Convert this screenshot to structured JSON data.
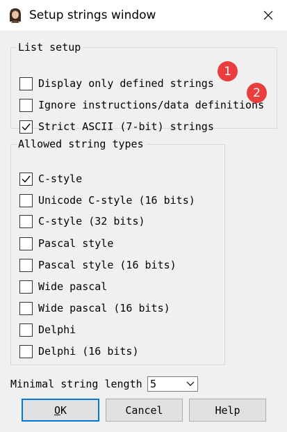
{
  "window": {
    "title": "Setup strings window",
    "icon": "portrait-icon"
  },
  "list_setup": {
    "legend": "List setup",
    "options": [
      {
        "label": "Display only defined strings",
        "checked": false,
        "badge": "1"
      },
      {
        "label": "Ignore instructions/data definitions",
        "checked": false,
        "badge": "2"
      },
      {
        "label": "Strict ASCII (7-bit) strings",
        "checked": true
      }
    ]
  },
  "string_types": {
    "legend": "Allowed string types",
    "options": [
      {
        "label": "C-style",
        "checked": true
      },
      {
        "label": "Unicode C-style (16 bits)",
        "checked": false
      },
      {
        "label": "C-style (32 bits)",
        "checked": false
      },
      {
        "label": "Pascal style",
        "checked": false
      },
      {
        "label": "Pascal style (16 bits)",
        "checked": false
      },
      {
        "label": "Wide pascal",
        "checked": false
      },
      {
        "label": "Wide pascal (16 bits)",
        "checked": false
      },
      {
        "label": "Delphi",
        "checked": false
      },
      {
        "label": "Delphi (16 bits)",
        "checked": false
      }
    ]
  },
  "min_length": {
    "label": "Minimal string length",
    "value": "5"
  },
  "buttons": {
    "ok_underlined": "O",
    "ok_rest": "K",
    "cancel": "Cancel",
    "help": "Help"
  },
  "colors": {
    "badge": "#ea3d3d",
    "default_button_border": "#0078d7"
  }
}
